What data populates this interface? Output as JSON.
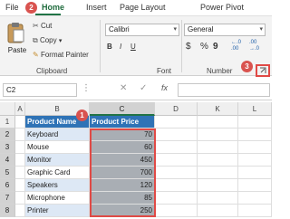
{
  "tabs": [
    "File",
    "Home",
    "Insert",
    "Page Layout",
    "Power Pivot"
  ],
  "callouts": [
    "1",
    "2",
    "3"
  ],
  "clipboard": {
    "paste": "Paste",
    "cut": "Cut",
    "copy": "Copy",
    "format_painter": "Format Painter",
    "group_label": "Clipboard"
  },
  "font": {
    "name": "Calibri",
    "group_label": "Font",
    "bold": "B",
    "italic": "I",
    "underline": "U"
  },
  "number": {
    "format": "General",
    "currency": "$",
    "percent": "%",
    "comma": "9",
    "group_label": "Number",
    "increase_decimal": "←.0",
    "increase_decimal_2": ".00",
    "decrease_decimal": ".00",
    "decrease_decimal_2": "→.0"
  },
  "formula_bar": {
    "name_box": "C2",
    "fx": "fx"
  },
  "columns": [
    "A",
    "B",
    "C",
    "D",
    "K",
    "L"
  ],
  "rows": [
    "1",
    "2",
    "3",
    "4",
    "5",
    "6",
    "7",
    "8"
  ],
  "table": {
    "header_name": "Product Name",
    "header_price": "Product Price",
    "items": [
      {
        "name": "Keyboard",
        "price": "70"
      },
      {
        "name": "Mouse",
        "price": "60"
      },
      {
        "name": "Monitor",
        "price": "450"
      },
      {
        "name": "Graphic Card",
        "price": "700"
      },
      {
        "name": "Speakers",
        "price": "120"
      },
      {
        "name": "Microphone",
        "price": "85"
      },
      {
        "name": "Printer",
        "price": "250"
      }
    ]
  },
  "colors": {
    "accent": "#217346",
    "header_fill": "#2f73b6",
    "callout": "#d9534f"
  }
}
